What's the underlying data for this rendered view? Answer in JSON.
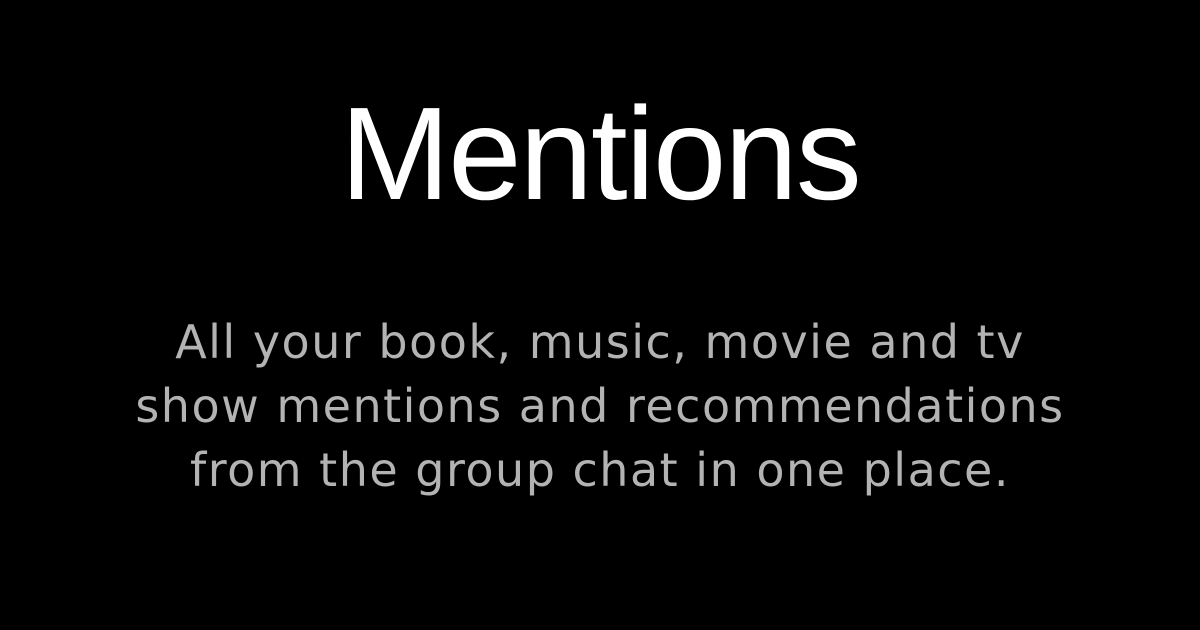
{
  "hero": {
    "title": "Mentions",
    "tagline_lines": [
      "All your book, music, movie and tv",
      "show mentions and recommendations",
      "from the group chat in one place."
    ]
  },
  "colors": {
    "background": "#000000",
    "title": "#ffffff",
    "tagline": "#b3b3b3"
  }
}
